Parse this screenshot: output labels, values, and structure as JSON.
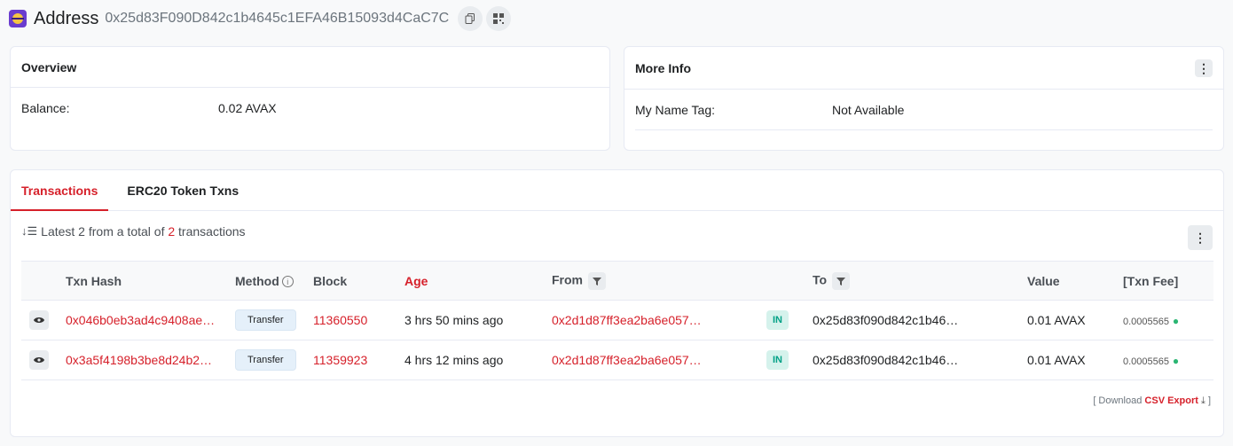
{
  "header": {
    "title": "Address",
    "address": "0x25d83F090D842c1b4645c1EFA46B15093d4CaC7C",
    "copy_icon": "copy-icon",
    "qr_icon": "qr-code-icon"
  },
  "overview": {
    "title": "Overview",
    "balance_label": "Balance:",
    "balance_value": "0.02 AVAX"
  },
  "more_info": {
    "title": "More Info",
    "name_tag_label": "My Name Tag:",
    "name_tag_value": "Not Available"
  },
  "tabs": [
    {
      "label": "Transactions",
      "active": true
    },
    {
      "label": "ERC20 Token Txns",
      "active": false
    }
  ],
  "summary": {
    "prefix": "Latest 2 from a total of",
    "count": "2",
    "suffix": "transactions"
  },
  "table": {
    "headers": {
      "txn_hash": "Txn Hash",
      "method": "Method",
      "block": "Block",
      "age": "Age",
      "from": "From",
      "to": "To",
      "value": "Value",
      "fee": "[Txn Fee]"
    },
    "rows": [
      {
        "hash": "0x046b0eb3ad4c9408ae…",
        "method": "Transfer",
        "block": "11360550",
        "age": "3 hrs 50 mins ago",
        "from": "0x2d1d87ff3ea2ba6e057…",
        "direction": "IN",
        "to": "0x25d83f090d842c1b46…",
        "value": "0.01 AVAX",
        "fee": "0.0005565"
      },
      {
        "hash": "0x3a5f4198b3be8d24b2…",
        "method": "Transfer",
        "block": "11359923",
        "age": "4 hrs 12 mins ago",
        "from": "0x2d1d87ff3ea2ba6e057…",
        "direction": "IN",
        "to": "0x25d83f090d842c1b46…",
        "value": "0.01 AVAX",
        "fee": "0.0005565"
      }
    ]
  },
  "export": {
    "open": "[ Download",
    "link": "CSV Export",
    "close": "]"
  },
  "colors": {
    "accent": "#d6202a",
    "in_badge_bg": "#d5f2ec",
    "in_badge_text": "#00a186"
  }
}
